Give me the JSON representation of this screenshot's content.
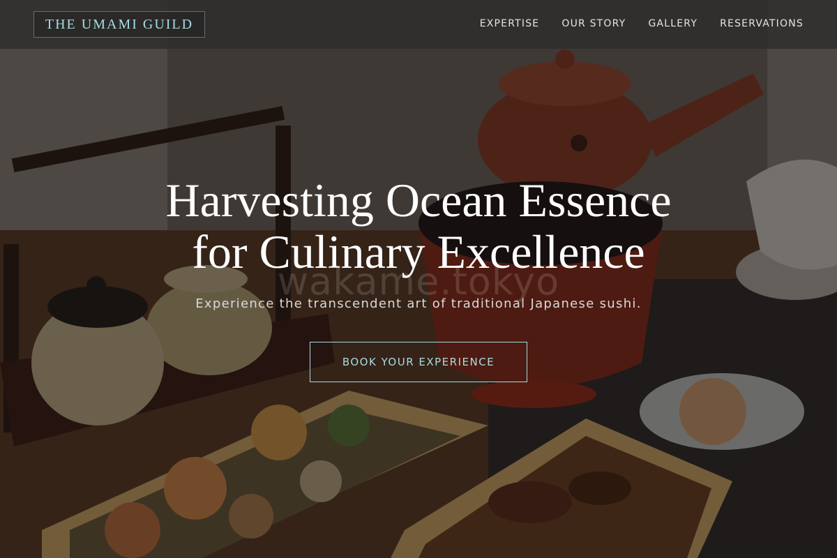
{
  "header": {
    "brand": "THE UMAMI GUILD",
    "nav": [
      {
        "label": "EXPERTISE"
      },
      {
        "label": "OUR STORY"
      },
      {
        "label": "GALLERY"
      },
      {
        "label": "RESERVATIONS"
      }
    ]
  },
  "hero": {
    "title_line1": "Harvesting Ocean Essence",
    "title_line2": "for Culinary Excellence",
    "subtitle": "Experience the transcendent art of traditional Japanese sushi.",
    "cta_label": "BOOK YOUR EXPERIENCE",
    "watermark": "wakame.tokyo"
  },
  "colors": {
    "accent": "#a7dce3",
    "nav_bg": "#2d2d2d",
    "text": "#ffffff"
  }
}
